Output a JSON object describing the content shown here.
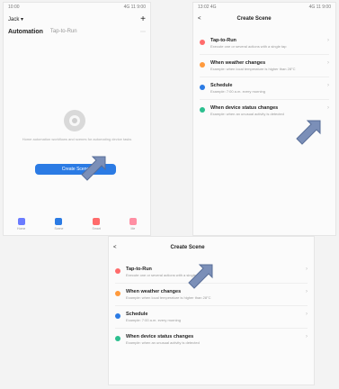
{
  "left_panel": {
    "status": {
      "time": "10:00",
      "right": "4G 11 9:00"
    },
    "account": "Jack ▾",
    "plus": "+",
    "tabs": [
      "Automation",
      "Tap-to-Run"
    ],
    "empty_text": "Home automation workflows and scenes for automating device tasks",
    "create_button": "Create Scene",
    "tabbar": [
      "Home",
      "Scene",
      "Smart",
      "Me"
    ],
    "tab_colors": [
      "#6b7cff",
      "#2b7be4",
      "#ff6b6b",
      "#ff8fa3"
    ]
  },
  "right_panel": {
    "status": {
      "left": "13:02 4G",
      "right": "4G 11 9:00"
    },
    "back": "<",
    "title": "Create Scene",
    "items": [
      {
        "title": "Tap-to-Run",
        "subtitle": "Execute one or several actions with a single tap",
        "color": "#ff6b6b"
      },
      {
        "title": "When weather changes",
        "subtitle": "Example: when local temperature is higher than 28°C",
        "color": "#ff9a3c"
      },
      {
        "title": "Schedule",
        "subtitle": "Example: 7:00 a.m. every morning",
        "color": "#2b7be4"
      },
      {
        "title": "When device status changes",
        "subtitle": "Example: when an unusual activity is detected",
        "color": "#2cbf8f"
      }
    ]
  },
  "bottom_panel": {
    "back": "<",
    "title": "Create Scene",
    "items": [
      {
        "title": "Tap-to-Run",
        "subtitle": "Execute one or several actions with a single tap",
        "color": "#ff6b6b"
      },
      {
        "title": "When weather changes",
        "subtitle": "Example: when local temperature is higher than 28°C",
        "color": "#ff9a3c"
      },
      {
        "title": "Schedule",
        "subtitle": "Example: 7:00 a.m. every morning",
        "color": "#2b7be4"
      },
      {
        "title": "When device status changes",
        "subtitle": "Example: when an unusual activity is detected",
        "color": "#2cbf8f"
      }
    ]
  }
}
